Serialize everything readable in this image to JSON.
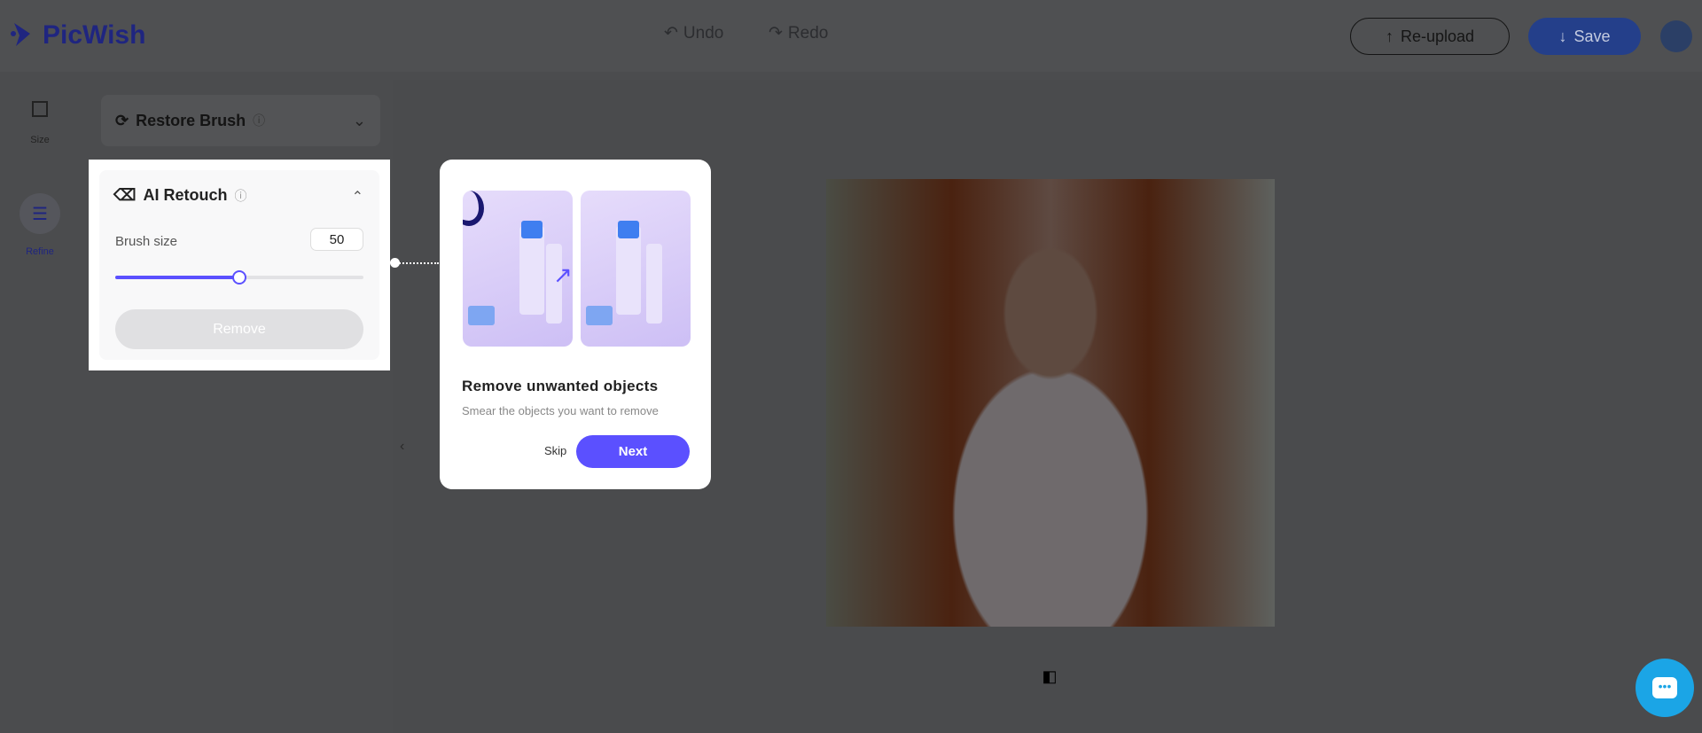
{
  "header": {
    "logo": "PicWish",
    "undo": "Undo",
    "redo": "Redo",
    "reupload": "Re-upload",
    "save": "Save"
  },
  "rail": [
    {
      "label": "Size",
      "icon": "crop-icon"
    },
    {
      "label": "Refine",
      "icon": "sliders-icon"
    }
  ],
  "panel": {
    "restore_brush": "Restore Brush",
    "ai_retouch": "AI Retouch",
    "brush_size_label": "Brush size",
    "brush_size_value": "50",
    "brush_size_fraction": 0.5,
    "remove": "Remove"
  },
  "tooltip": {
    "title": "Remove unwanted objects",
    "subtitle": "Smear the objects you want to remove",
    "skip": "Skip",
    "next": "Next"
  },
  "colors": {
    "accent": "#5b50ff",
    "save": "#3d6cf0",
    "chat": "#1ba5e6"
  }
}
